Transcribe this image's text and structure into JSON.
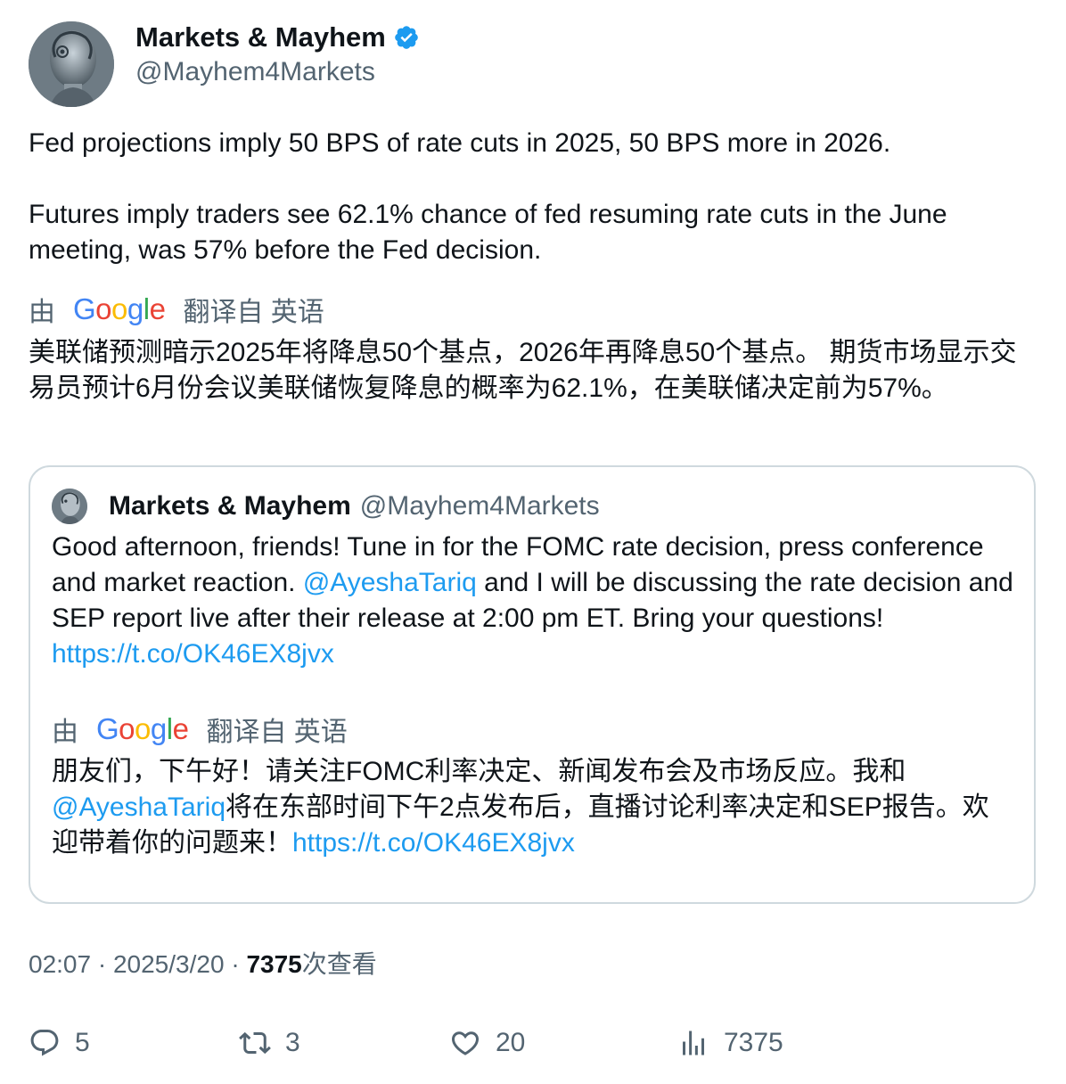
{
  "author": {
    "name": "Markets & Mayhem",
    "handle": "@Mayhem4Markets"
  },
  "tweet": {
    "paragraph1": "Fed projections imply 50 BPS of rate cuts in 2025, 50 BPS more in 2026.",
    "paragraph2": "Futures imply traders see 62.1% chance of fed resuming rate cuts in the June meeting, was 57% before the Fed decision.",
    "translate_prefix": "由",
    "translate_logo": "Google",
    "translate_suffix": "翻译自 英语",
    "translated_text": "美联储预测暗示2025年将降息50个基点，2026年再降息50个基点。 期货市场显示交易员预计6月份会议美联储恢复降息的概率为62.1%，在美联储决定前为57%。"
  },
  "quote": {
    "name": "Markets & Mayhem",
    "handle": "@Mayhem4Markets",
    "text_part1": "Good afternoon, friends! Tune in for the FOMC rate decision, press conference and market reaction. ",
    "mention": "@AyeshaTariq",
    "text_part2": " and I will be discussing the rate decision and SEP report live after their release at 2:00 pm ET. Bring your questions! ",
    "link": "https://t.co/OK46EX8jvx",
    "translate_prefix": "由",
    "translate_logo": "Google",
    "translate_suffix": "翻译自 英语",
    "translated_part1": "朋友们，下午好！请关注FOMC利率决定、新闻发布会及市场反应。我和",
    "translated_mention": "@AyeshaTariq",
    "translated_part2": "将在东部时间下午2点发布后，直播讨论利率决定和SEP报告。欢迎带着你的问题来！",
    "translated_link": "https://t.co/OK46EX8jvx"
  },
  "meta": {
    "time": "02:07",
    "date": "2025/3/20",
    "views": "7375",
    "views_label": "次查看",
    "separator": "·"
  },
  "actions": {
    "replies": "5",
    "retweets": "3",
    "likes": "20",
    "views": "7375"
  },
  "colors": {
    "link": "#1d9bf0",
    "verified": "#1d9bf0",
    "secondary_text": "#536471",
    "border": "#cfd9de"
  }
}
